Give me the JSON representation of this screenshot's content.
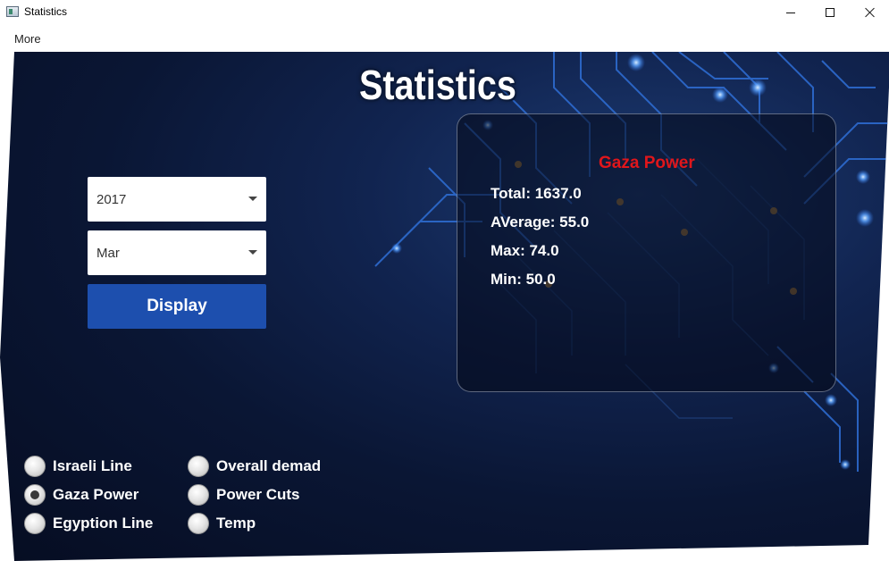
{
  "window": {
    "title": "Statistics"
  },
  "menu": {
    "items": [
      {
        "label": "More"
      }
    ]
  },
  "main": {
    "title": "Statistics",
    "year_select": {
      "value": "2017"
    },
    "month_select": {
      "value": "Mar"
    },
    "display_button": {
      "label": "Display"
    }
  },
  "stats": {
    "heading": "Gaza Power",
    "total": "Total: 1637.0",
    "average": "AVerage: 55.0",
    "max": "Max: 74.0",
    "min": "Min: 50.0"
  },
  "options": [
    {
      "label": "Israeli Line",
      "checked": false
    },
    {
      "label": "Gaza Power",
      "checked": true
    },
    {
      "label": "Egyption Line",
      "checked": false
    },
    {
      "label": "Overall demad",
      "checked": false
    },
    {
      "label": "Power Cuts",
      "checked": false
    },
    {
      "label": "Temp",
      "checked": false
    }
  ],
  "colors": {
    "background": "#0a1634",
    "button": "#1d4fae",
    "heading_red": "#e0161b",
    "circuit_glow": "#3d8bff"
  }
}
